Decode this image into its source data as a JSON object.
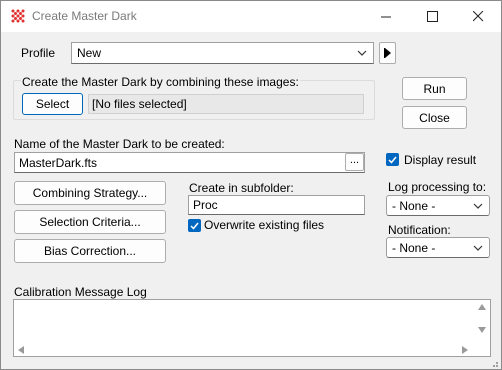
{
  "window": {
    "title": "Create Master Dark",
    "controls": {
      "minimize": "—",
      "maximize": "☐",
      "close": "✕"
    }
  },
  "profile": {
    "label": "Profile",
    "value": "New"
  },
  "images": {
    "group_label": "Create the Master Dark by combining these images:",
    "select_label": "Select",
    "files_value": "[No files selected]"
  },
  "actions": {
    "run_label": "Run",
    "close_label": "Close"
  },
  "output": {
    "name_label": "Name of the Master Dark to be created:",
    "name_value": "MasterDark.fts",
    "browse_label": "...",
    "display_result_label": "Display result",
    "display_result_checked": true
  },
  "options": {
    "combining_strategy_label": "Combining Strategy...",
    "selection_criteria_label": "Selection Criteria...",
    "bias_correction_label": "Bias Correction..."
  },
  "subfolder": {
    "label": "Create in subfolder:",
    "value": "Proc",
    "overwrite_label": "Overwrite existing files",
    "overwrite_checked": true
  },
  "logging": {
    "log_processing_label": "Log processing to:",
    "log_processing_value": "- None -",
    "notification_label": "Notification:",
    "notification_value": "- None -"
  },
  "message_log": {
    "label": "Calibration Message Log"
  },
  "colors": {
    "accent": "#0067c0",
    "app_icon": "#e03030"
  }
}
